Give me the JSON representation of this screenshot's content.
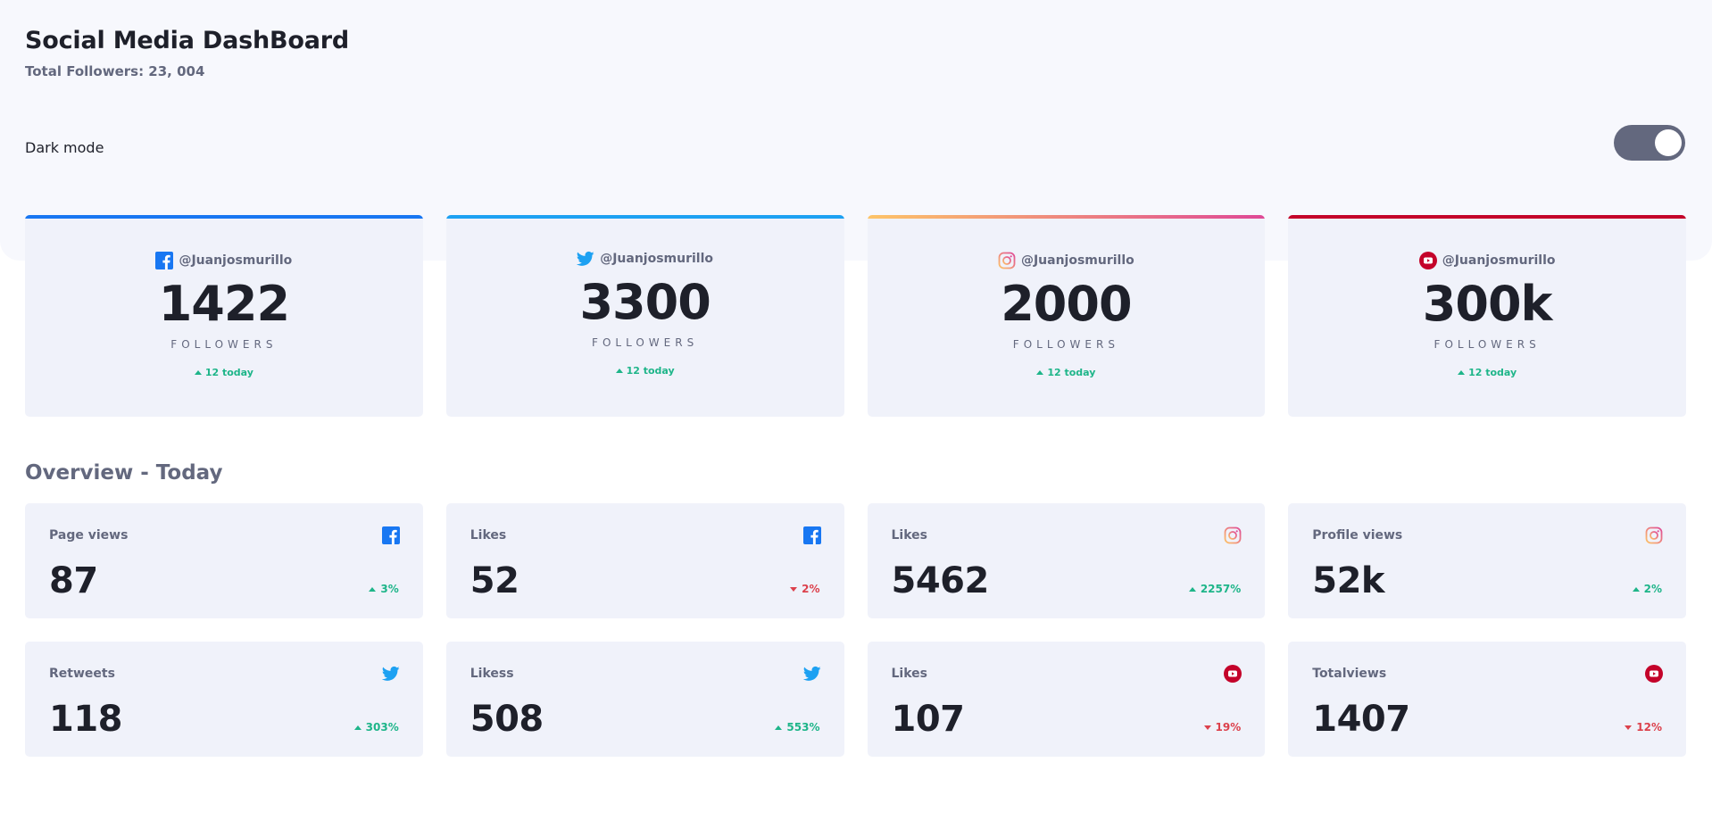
{
  "header": {
    "title": "Social Media DashBoard",
    "subtitle": "Total Followers: 23, 004"
  },
  "dark_mode": {
    "label": "Dark mode",
    "enabled": true
  },
  "colors": {
    "facebook": "#1877f2",
    "twitter": "#1da1f2",
    "instagram_start": "#fdc468",
    "instagram_end": "#df4996",
    "youtube": "#c4032a",
    "positive": "#1eb589",
    "negative": "#dc414c"
  },
  "followers": [
    {
      "network": "facebook",
      "icon": "facebook-icon",
      "handle": "@Juanjosmurillo",
      "count": "1422",
      "label": "FOLLOWERS",
      "today": "12 today"
    },
    {
      "network": "twitter",
      "icon": "twitter-icon",
      "handle": "@Juanjosmurillo",
      "count": "3300",
      "label": "FOLLOWERS",
      "today": "12 today"
    },
    {
      "network": "instagram",
      "icon": "instagram-icon",
      "handle": "@Juanjosmurillo",
      "count": "2000",
      "label": "FOLLOWERS",
      "today": "12 today"
    },
    {
      "network": "youtube",
      "icon": "youtube-icon",
      "handle": "@Juanjosmurillo",
      "count": "300k",
      "label": "FOLLOWERS",
      "today": "12 today"
    }
  ],
  "overview": {
    "title": "Overview - Today",
    "cards": [
      {
        "label": "Page views",
        "network": "facebook",
        "value": "87",
        "delta": "3%",
        "direction": "up"
      },
      {
        "label": "Likes",
        "network": "facebook",
        "value": "52",
        "delta": "2%",
        "direction": "down"
      },
      {
        "label": "Likes",
        "network": "instagram",
        "value": "5462",
        "delta": "2257%",
        "direction": "up"
      },
      {
        "label": "Profile views",
        "network": "instagram",
        "value": "52k",
        "delta": "2%",
        "direction": "up"
      },
      {
        "label": "Retweets",
        "network": "twitter",
        "value": "118",
        "delta": "303%",
        "direction": "up"
      },
      {
        "label": "Likess",
        "network": "twitter",
        "value": "508",
        "delta": "553%",
        "direction": "up"
      },
      {
        "label": "Likes",
        "network": "youtube",
        "value": "107",
        "delta": "19%",
        "direction": "down"
      },
      {
        "label": "Totalviews",
        "network": "youtube",
        "value": "1407",
        "delta": "12%",
        "direction": "down"
      }
    ]
  }
}
